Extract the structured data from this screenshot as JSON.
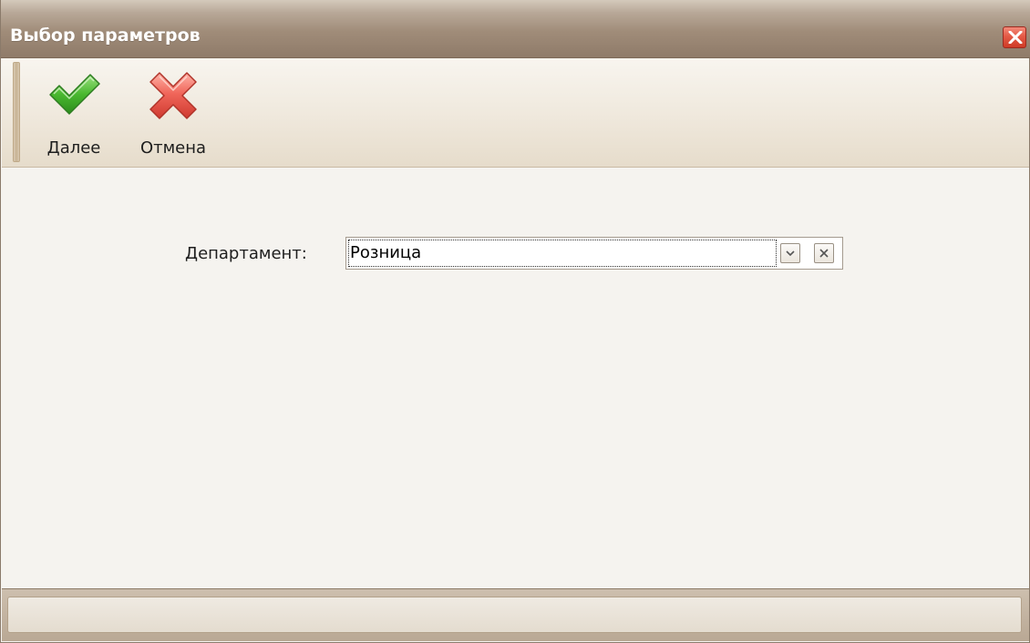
{
  "window": {
    "title": "Выбор параметров"
  },
  "toolbar": {
    "next_label": "Далее",
    "cancel_label": "Отмена"
  },
  "form": {
    "department_label": "Департамент:",
    "department_value": "Розница"
  },
  "statusbar": {
    "text": ""
  },
  "icons": {
    "close": "close-icon",
    "next": "checkmark-icon",
    "cancel": "cross-icon",
    "dropdown": "chevron-down-icon",
    "clear": "clear-icon"
  },
  "colors": {
    "titlebar": "#a08c79",
    "close_button": "#e45a46",
    "check_green": "#3fae2a",
    "cross_red": "#e0524a",
    "content_bg": "#f5f3ef"
  }
}
